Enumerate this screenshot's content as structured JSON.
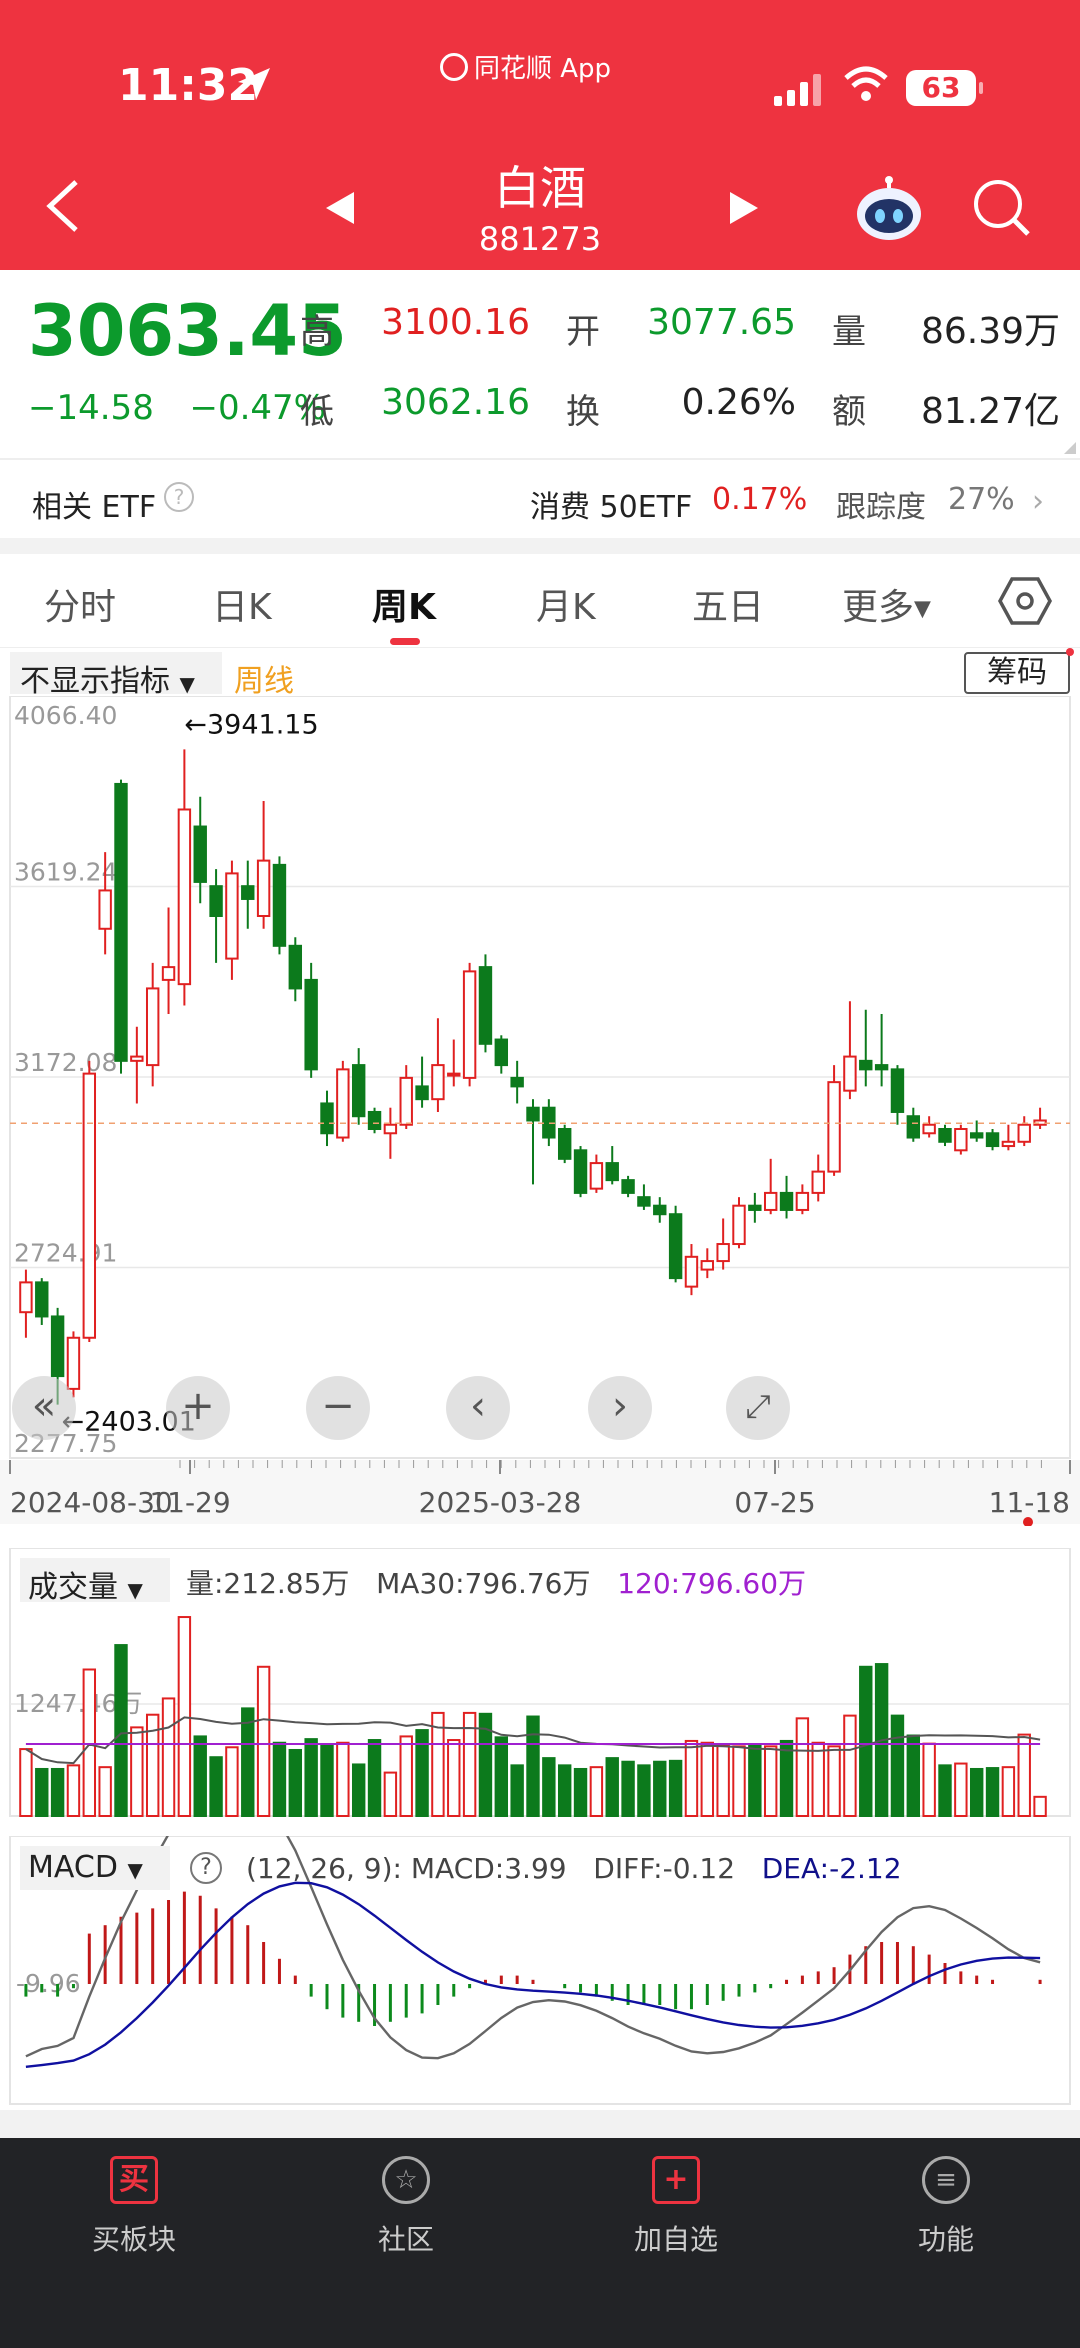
{
  "status": {
    "time": "11:32",
    "app_label": "同花顺 App",
    "battery": "63"
  },
  "header": {
    "title": "白酒",
    "code": "881273"
  },
  "quote": {
    "price": "3063.45",
    "change": "−14.58",
    "change_pct": "−0.47%",
    "high_label": "高",
    "high": "3100.16",
    "low_label": "低",
    "low": "3062.16",
    "open_label": "开",
    "open": "3077.65",
    "turnover_label": "换",
    "turnover": "0.26%",
    "volume_label": "量",
    "volume": "86.39万",
    "amount_label": "额",
    "amount": "81.27亿"
  },
  "etf": {
    "label": "相关 ETF",
    "help": "?",
    "name": "消费 50ETF",
    "change": "0.17%",
    "track_label": "跟踪度",
    "track_value": "27%"
  },
  "tabs": [
    {
      "label": "分时"
    },
    {
      "label": "日K"
    },
    {
      "label": "周K"
    },
    {
      "label": "月K"
    },
    {
      "label": "五日"
    },
    {
      "label": "更多"
    }
  ],
  "chart_controls": {
    "indicator": "不显示指标",
    "period": "周线",
    "chips": "筹码"
  },
  "chart_data": [
    {
      "type": "candlestick",
      "y_ticks": [
        "4066.40",
        "3619.24",
        "3172.08",
        "2724.91",
        "2277.75"
      ],
      "ylim": [
        2277.75,
        4066.4
      ],
      "x_ticks": [
        "2024-08-30",
        "11-29",
        "2025-03-28",
        "07-25",
        "11-18"
      ],
      "annotations": {
        "max": "←3941.15",
        "min": "←2403.01"
      },
      "current_line": 3063.45,
      "series": [
        {
          "o": 2620,
          "c": 2690,
          "h": 2720,
          "l": 2560
        },
        {
          "o": 2690,
          "c": 2610,
          "h": 2700,
          "l": 2590
        },
        {
          "o": 2610,
          "c": 2470,
          "h": 2630,
          "l": 2403
        },
        {
          "o": 2440,
          "c": 2560,
          "h": 2575,
          "l": 2420
        },
        {
          "o": 2560,
          "c": 3180,
          "h": 3210,
          "l": 2550
        },
        {
          "o": 3520,
          "c": 3610,
          "h": 3700,
          "l": 3460
        },
        {
          "o": 3860,
          "c": 3210,
          "h": 3870,
          "l": 3180
        },
        {
          "o": 3210,
          "c": 3220,
          "h": 3290,
          "l": 3110
        },
        {
          "o": 3200,
          "c": 3380,
          "h": 3440,
          "l": 3150
        },
        {
          "o": 3400,
          "c": 3430,
          "h": 3570,
          "l": 3320
        },
        {
          "o": 3390,
          "c": 3800,
          "h": 3941,
          "l": 3340
        },
        {
          "o": 3760,
          "c": 3630,
          "h": 3830,
          "l": 3580
        },
        {
          "o": 3620,
          "c": 3550,
          "h": 3660,
          "l": 3440
        },
        {
          "o": 3450,
          "c": 3650,
          "h": 3680,
          "l": 3400
        },
        {
          "o": 3620,
          "c": 3590,
          "h": 3680,
          "l": 3520
        },
        {
          "o": 3550,
          "c": 3680,
          "h": 3820,
          "l": 3520
        },
        {
          "o": 3670,
          "c": 3480,
          "h": 3690,
          "l": 3460
        },
        {
          "o": 3480,
          "c": 3380,
          "h": 3500,
          "l": 3350
        },
        {
          "o": 3400,
          "c": 3190,
          "h": 3440,
          "l": 3170
        },
        {
          "o": 3110,
          "c": 3040,
          "h": 3140,
          "l": 3010
        },
        {
          "o": 3030,
          "c": 3190,
          "h": 3210,
          "l": 3020
        },
        {
          "o": 3200,
          "c": 3080,
          "h": 3240,
          "l": 3060
        },
        {
          "o": 3090,
          "c": 3050,
          "h": 3100,
          "l": 3040
        },
        {
          "o": 3040,
          "c": 3060,
          "h": 3100,
          "l": 2980
        },
        {
          "o": 3060,
          "c": 3170,
          "h": 3200,
          "l": 3050
        },
        {
          "o": 3150,
          "c": 3120,
          "h": 3220,
          "l": 3100
        },
        {
          "o": 3120,
          "c": 3200,
          "h": 3310,
          "l": 3090
        },
        {
          "o": 3180,
          "c": 3180,
          "h": 3260,
          "l": 3150
        },
        {
          "o": 3170,
          "c": 3420,
          "h": 3440,
          "l": 3150
        },
        {
          "o": 3430,
          "c": 3250,
          "h": 3460,
          "l": 3230
        },
        {
          "o": 3260,
          "c": 3200,
          "h": 3270,
          "l": 3180
        },
        {
          "o": 3170,
          "c": 3150,
          "h": 3210,
          "l": 3110
        },
        {
          "o": 3100,
          "c": 3070,
          "h": 3120,
          "l": 2920
        },
        {
          "o": 3100,
          "c": 3030,
          "h": 3120,
          "l": 3010
        },
        {
          "o": 3050,
          "c": 2980,
          "h": 3060,
          "l": 2970
        },
        {
          "o": 3000,
          "c": 2900,
          "h": 3010,
          "l": 2890
        },
        {
          "o": 2910,
          "c": 2970,
          "h": 2990,
          "l": 2900
        },
        {
          "o": 2970,
          "c": 2930,
          "h": 3010,
          "l": 2920
        },
        {
          "o": 2930,
          "c": 2900,
          "h": 2940,
          "l": 2890
        },
        {
          "o": 2890,
          "c": 2870,
          "h": 2920,
          "l": 2860
        },
        {
          "o": 2870,
          "c": 2850,
          "h": 2890,
          "l": 2830
        },
        {
          "o": 2850,
          "c": 2700,
          "h": 2870,
          "l": 2690
        },
        {
          "o": 2680,
          "c": 2750,
          "h": 2780,
          "l": 2660
        },
        {
          "o": 2720,
          "c": 2740,
          "h": 2770,
          "l": 2700
        },
        {
          "o": 2740,
          "c": 2780,
          "h": 2840,
          "l": 2720
        },
        {
          "o": 2780,
          "c": 2870,
          "h": 2890,
          "l": 2770
        },
        {
          "o": 2870,
          "c": 2860,
          "h": 2900,
          "l": 2830
        },
        {
          "o": 2860,
          "c": 2900,
          "h": 2980,
          "l": 2850
        },
        {
          "o": 2900,
          "c": 2860,
          "h": 2940,
          "l": 2840
        },
        {
          "o": 2860,
          "c": 2900,
          "h": 2920,
          "l": 2850
        },
        {
          "o": 2900,
          "c": 2950,
          "h": 2990,
          "l": 2880
        },
        {
          "o": 2950,
          "c": 3160,
          "h": 3200,
          "l": 2940
        },
        {
          "o": 3140,
          "c": 3220,
          "h": 3350,
          "l": 3120
        },
        {
          "o": 3210,
          "c": 3190,
          "h": 3330,
          "l": 3150
        },
        {
          "o": 3200,
          "c": 3190,
          "h": 3320,
          "l": 3150
        },
        {
          "o": 3190,
          "c": 3090,
          "h": 3200,
          "l": 3060
        },
        {
          "o": 3080,
          "c": 3030,
          "h": 3100,
          "l": 3020
        },
        {
          "o": 3040,
          "c": 3060,
          "h": 3080,
          "l": 3030
        },
        {
          "o": 3050,
          "c": 3020,
          "h": 3060,
          "l": 3010
        },
        {
          "o": 3000,
          "c": 3050,
          "h": 3060,
          "l": 2990
        },
        {
          "o": 3040,
          "c": 3030,
          "h": 3070,
          "l": 3020
        },
        {
          "o": 3040,
          "c": 3010,
          "h": 3050,
          "l": 3000
        },
        {
          "o": 3010,
          "c": 3020,
          "h": 3060,
          "l": 3000
        },
        {
          "o": 3020,
          "c": 3060,
          "h": 3080,
          "l": 3010
        },
        {
          "o": 3060,
          "c": 3070,
          "h": 3100,
          "l": 3050
        }
      ]
    },
    {
      "type": "bar",
      "label": "成交量",
      "y_tick": "1247.46万",
      "stats": {
        "vol": "量:212.85万",
        "ma30": "MA30:796.76万",
        "ma120": "120:796.60万"
      },
      "values": [
        740,
        520,
        520,
        560,
        1620,
        540,
        1890,
        980,
        1120,
        1300,
        2200,
        880,
        650,
        760,
        1190,
        1650,
        810,
        730,
        850,
        790,
        810,
        570,
        840,
        480,
        880,
        950,
        1140,
        840,
        1140,
        1130,
        870,
        560,
        1100,
        640,
        560,
        520,
        540,
        640,
        600,
        560,
        600,
        610,
        830,
        810,
        780,
        770,
        790,
        770,
        830,
        1080,
        810,
        770,
        1110,
        1650,
        1680,
        1110,
        890,
        800,
        560,
        580,
        520,
        530,
        540,
        900,
        212
      ]
    },
    {
      "type": "bar",
      "label": "MACD",
      "params": "(12, 26, 9):",
      "stats": {
        "macd": "MACD:3.99",
        "diff": "DIFF:-0.12",
        "dea": "DEA:-2.12"
      },
      "y_tick": "-9.96",
      "values": [
        -3,
        -2,
        -3,
        -1,
        12,
        14,
        16,
        17,
        18,
        20,
        22,
        21,
        18,
        16,
        14,
        10,
        6,
        2,
        -3,
        -6,
        -8,
        -9,
        -10,
        -9,
        -8,
        -7,
        -5,
        -3,
        -1,
        1,
        2,
        2,
        1,
        0,
        -1,
        -2,
        -3,
        -4,
        -5,
        -5,
        -5,
        -6,
        -6,
        -5,
        -4,
        -3,
        -2,
        -1,
        1,
        2,
        3,
        4,
        7,
        9,
        10,
        10,
        9,
        7,
        5,
        3,
        2,
        1,
        0,
        0,
        1
      ]
    }
  ],
  "controls": {
    "collapse": "«",
    "zoom_in": "+",
    "zoom_out": "−",
    "prev": "‹",
    "next": "›",
    "fullscreen": "⤢"
  },
  "bottom_bar": [
    {
      "label": "买板块",
      "icon": "买"
    },
    {
      "label": "社区",
      "icon": "☆"
    },
    {
      "label": "加自选",
      "icon": "+"
    },
    {
      "label": "功能",
      "icon": "≡"
    }
  ]
}
